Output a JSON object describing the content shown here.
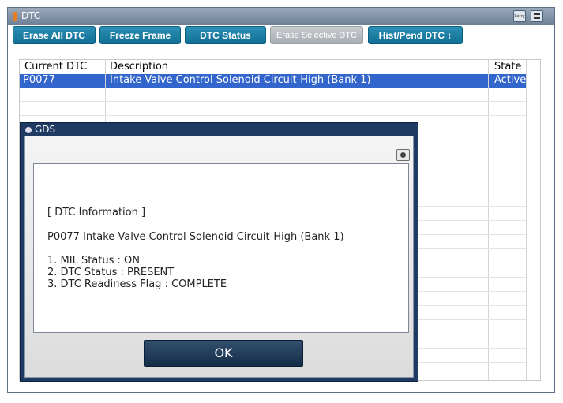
{
  "window": {
    "title": "DTC",
    "retry_label": "Retry"
  },
  "toolbar": {
    "buttons": [
      {
        "label": "Erase All DTC",
        "enabled": true
      },
      {
        "label": "Freeze Frame",
        "enabled": true
      },
      {
        "label": "DTC Status",
        "enabled": true
      },
      {
        "label": "Erase Selective DTC",
        "enabled": false
      },
      {
        "label": "Hist/Pend DTC ↕",
        "enabled": true
      }
    ]
  },
  "table": {
    "headers": {
      "code": "Current DTC",
      "description": "Description",
      "state": "State"
    },
    "rows": [
      {
        "code": "P0077",
        "description": "Intake Valve Control Solenoid Circuit-High (Bank 1)",
        "state": "Active",
        "selected": true
      }
    ]
  },
  "dialog": {
    "title": "GDS",
    "info": {
      "heading": "[ DTC Information ]",
      "code_line": "P0077 Intake Valve Control Solenoid Circuit-High (Bank 1)",
      "items": [
        "1. MIL Status : ON",
        "2. DTC Status : PRESENT",
        "3. DTC Readiness Flag : COMPLETE"
      ]
    },
    "ok_label": "OK"
  }
}
